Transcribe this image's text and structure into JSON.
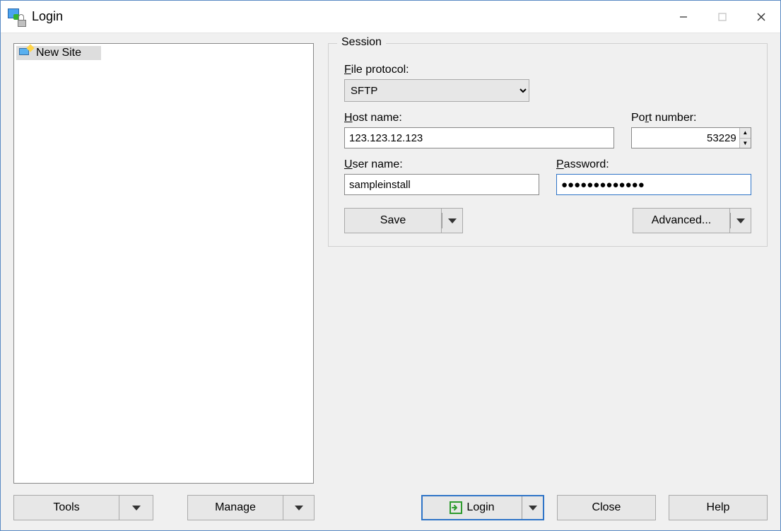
{
  "window": {
    "title": "Login"
  },
  "sitelist": {
    "items": [
      {
        "label": "New Site"
      }
    ]
  },
  "session": {
    "legend": "Session",
    "file_protocol_label_pre": "F",
    "file_protocol_label_post": "ile protocol:",
    "file_protocol_value": "SFTP",
    "host_label_pre": "H",
    "host_label_post": "ost name:",
    "host_value": "123.123.12.123",
    "port_label_pre": "Po",
    "port_label_ul": "r",
    "port_label_post": "t number:",
    "port_value": "53229",
    "user_label_pre": "U",
    "user_label_post": "ser name:",
    "user_value": "sampleinstall",
    "pass_label_pre": "P",
    "pass_label_post": "assword:",
    "pass_value": "●●●●●●●●●●●●●",
    "save_label": "Save",
    "advanced_label": "Advanced..."
  },
  "bottom": {
    "tools_label": "Tools",
    "manage_label": "Manage",
    "login_label": "Login",
    "close_label": "Close",
    "help_label": "Help"
  }
}
